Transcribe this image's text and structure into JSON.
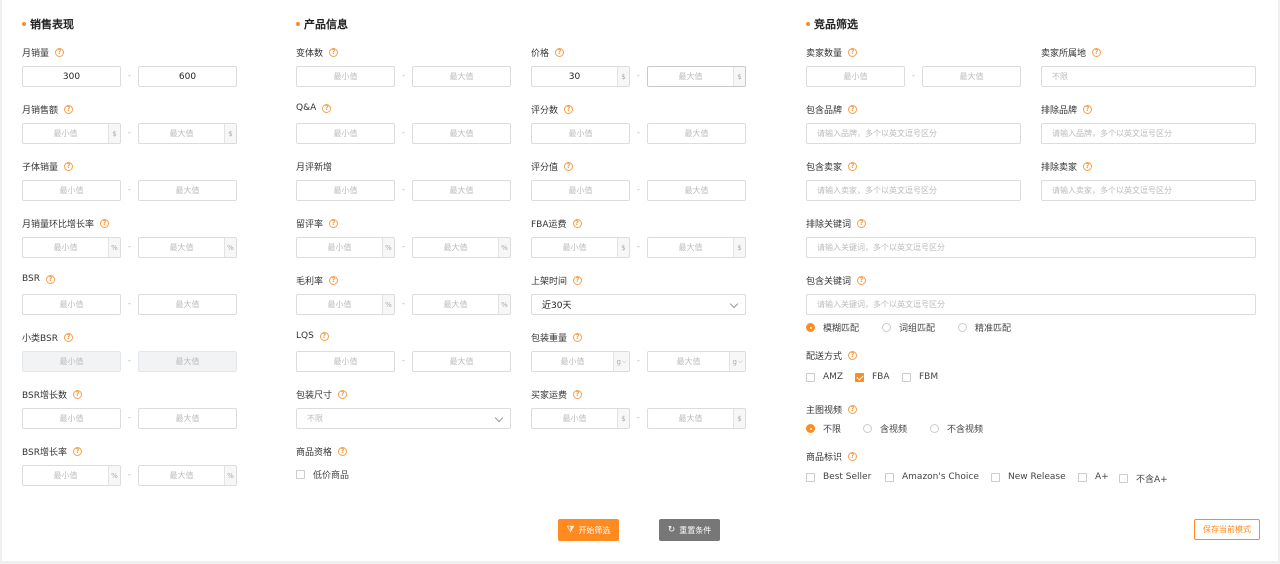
{
  "sections": {
    "sales": "销售表现",
    "product": "产品信息",
    "competitor": "竞品筛选"
  },
  "ph": {
    "min": "最小值",
    "max": "最大值",
    "brand": "请输入品牌，多个以英文逗号区分",
    "seller": "请输入卖家，多个以英文逗号区分",
    "keyword": "请输入关键词，多个以英文逗号区分",
    "unlimited": "不限"
  },
  "units": {
    "dollar": "$",
    "percent": "%",
    "gram": "g"
  },
  "sales": {
    "monthly_sales": {
      "label": "月销量",
      "min": "300",
      "max": "600"
    },
    "monthly_revenue": {
      "label": "月销售额"
    },
    "child_sales": {
      "label": "子体销量"
    },
    "sales_growth": {
      "label": "月销量环比增长率"
    },
    "bsr": {
      "label": "BSR"
    },
    "sub_bsr": {
      "label": "小类BSR"
    },
    "bsr_growth_count": {
      "label": "BSR增长数"
    },
    "bsr_growth_rate": {
      "label": "BSR增长率"
    }
  },
  "product": {
    "variants": {
      "label": "变体数"
    },
    "qa": {
      "label": "Q&A"
    },
    "monthly_reviews": {
      "label": "月评新增"
    },
    "review_rate": {
      "label": "留评率"
    },
    "gross_margin": {
      "label": "毛利率"
    },
    "lqs": {
      "label": "LQS"
    },
    "package_size": {
      "label": "包装尺寸",
      "value": "不限"
    },
    "eligibility": {
      "label": "商品资格",
      "option": "低价商品"
    },
    "price": {
      "label": "价格",
      "min": "30"
    },
    "rating_count": {
      "label": "评分数"
    },
    "rating": {
      "label": "评分值"
    },
    "fba_fee": {
      "label": "FBA运费"
    },
    "listing_time": {
      "label": "上架时间",
      "value": "近30天"
    },
    "package_weight": {
      "label": "包装重量"
    },
    "buyer_shipping": {
      "label": "买家运费"
    }
  },
  "competitor": {
    "seller_count": {
      "label": "卖家数量"
    },
    "seller_location": {
      "label": "卖家所属地"
    },
    "include_brand": {
      "label": "包含品牌"
    },
    "exclude_brand": {
      "label": "排除品牌"
    },
    "include_seller": {
      "label": "包含卖家"
    },
    "exclude_seller": {
      "label": "排除卖家"
    },
    "exclude_keyword": {
      "label": "排除关键词"
    },
    "include_keyword": {
      "label": "包含关键词"
    },
    "match_modes": [
      "模糊匹配",
      "词组匹配",
      "精准匹配"
    ],
    "match_selected": 0,
    "shipping": {
      "label": "配送方式",
      "options": [
        "AMZ",
        "FBA",
        "FBM"
      ],
      "checked": [
        false,
        true,
        false
      ]
    },
    "main_video": {
      "label": "主图视频",
      "options": [
        "不限",
        "含视频",
        "不含视频"
      ],
      "selected": 0
    },
    "tags": {
      "label": "商品标识",
      "options": [
        "Best Seller",
        "Amazon's Choice",
        "New Release",
        "A+",
        "不含A+"
      ]
    }
  },
  "buttons": {
    "start": "开始筛选",
    "reset": "重置条件",
    "save": "保存当前模式"
  },
  "colors": {
    "accent": "#ff8a1f",
    "gray_button": "#777777"
  }
}
